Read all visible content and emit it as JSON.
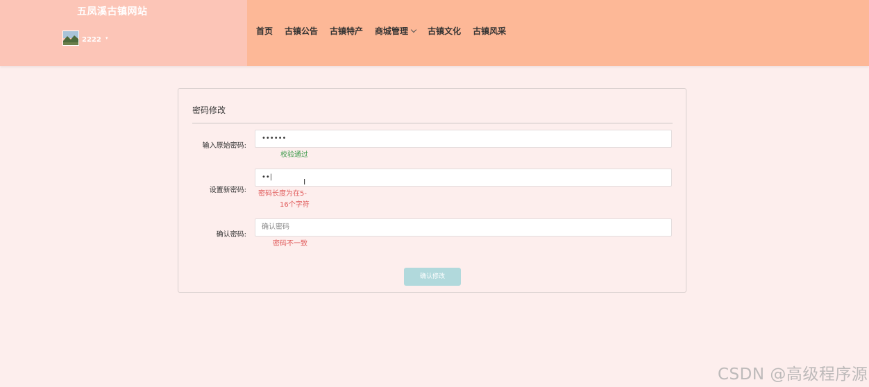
{
  "site": {
    "title": "五凤溪古镇网站",
    "username": "2222",
    "caret": "▾"
  },
  "nav": {
    "items": [
      {
        "label": "首页"
      },
      {
        "label": "古镇公告"
      },
      {
        "label": "古镇特产"
      },
      {
        "label": "商城管理"
      },
      {
        "label": "古镇文化"
      },
      {
        "label": "古镇风采"
      }
    ]
  },
  "form": {
    "title": "密码修改",
    "old_password": {
      "label": "输入原始密码:",
      "value": "••••••",
      "message": "校验通过"
    },
    "new_password": {
      "label": "设置新密码:",
      "value": "••|",
      "message_line1": "密码长度为在5-",
      "message_line2": "16个字符"
    },
    "confirm_password": {
      "label": "确认密码:",
      "placeholder": "确认密码",
      "message": "密码不一致"
    },
    "submit_label": "确认修改"
  },
  "cursor_glyph": "I",
  "watermark": "CSDN @高级程序源",
  "colors": {
    "header_bg": "#fdb897",
    "brand_bg": "#fcc5b7",
    "page_bg": "#fdeeed",
    "ok": "#3c9a4a",
    "error": "#e05a5a",
    "button_bg": "#b1d9dc"
  }
}
